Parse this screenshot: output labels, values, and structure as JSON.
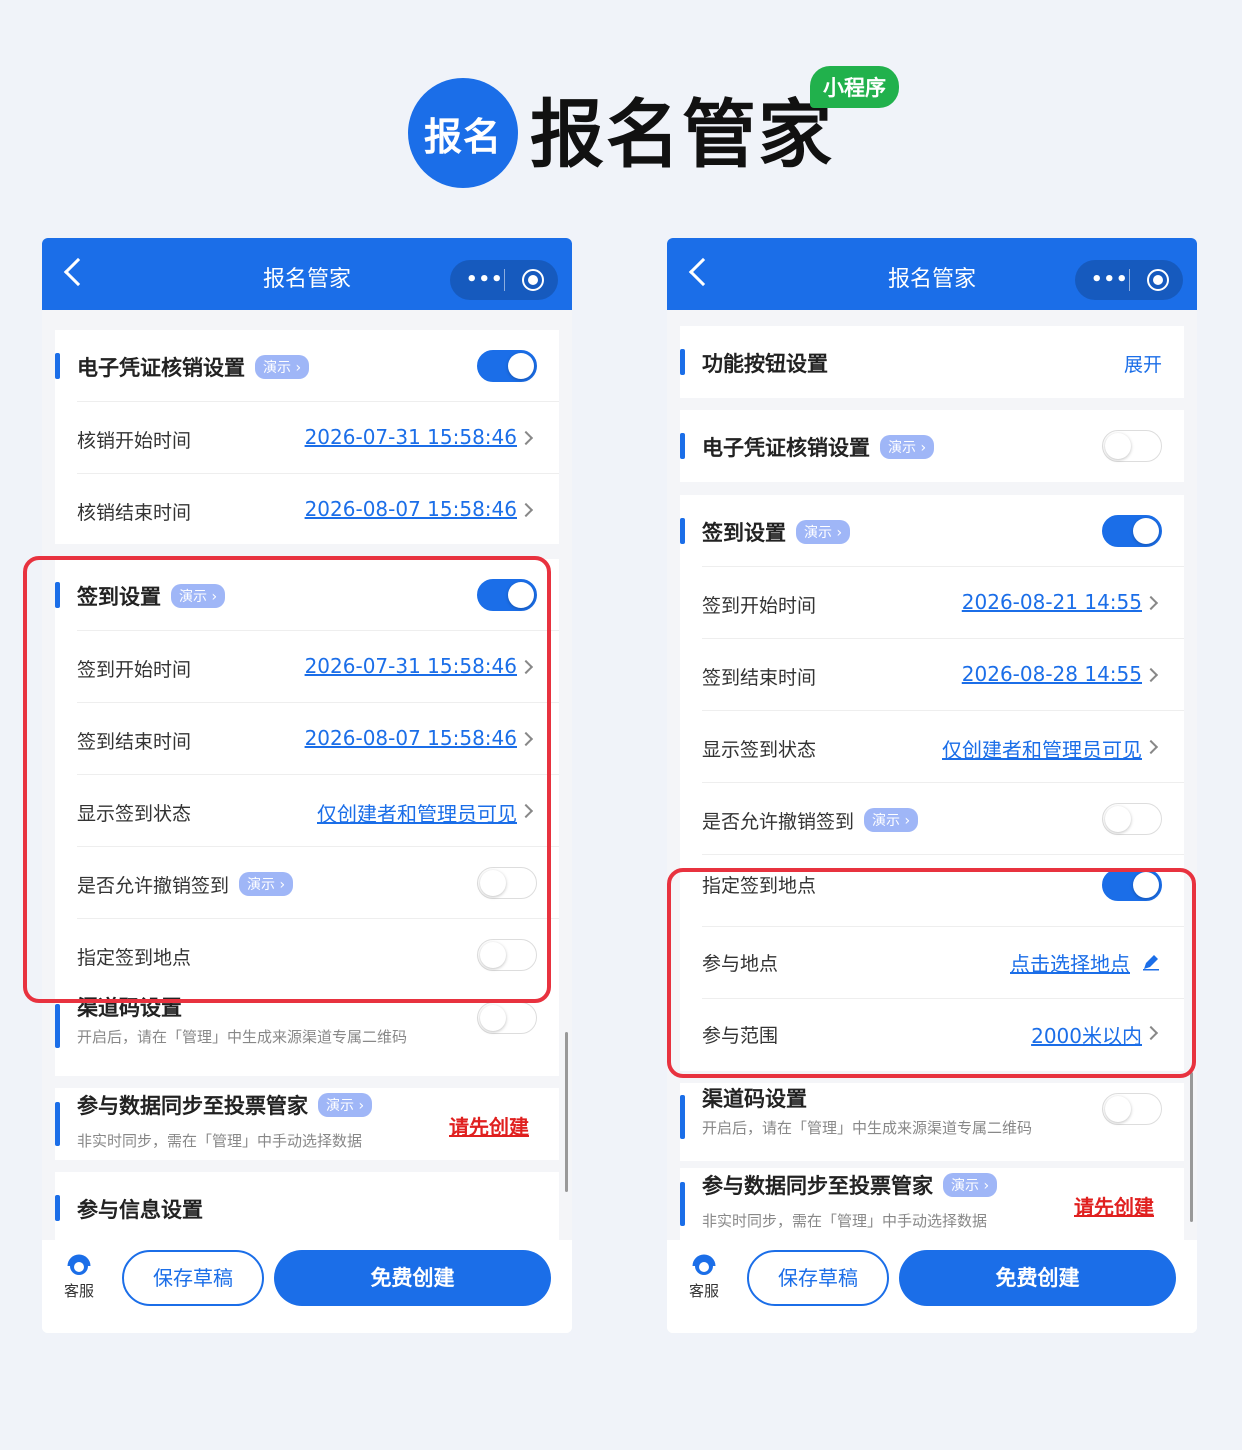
{
  "logo": {
    "circle_text": "报名",
    "app_name": "报名管家",
    "mini_badge": "小程序"
  },
  "colors": {
    "primary": "#1b6ee8",
    "highlight": "#e8323f",
    "warn": "#e0201f",
    "badge_green": "#21b14c"
  },
  "left": {
    "nav_title": "报名管家",
    "voucher": {
      "title": "电子凭证核销设置",
      "badge": "演示 ›",
      "toggle": "on"
    },
    "voucher_start": {
      "label": "核销开始时间",
      "value": "2026-07-31 15:58:46"
    },
    "voucher_end": {
      "label": "核销结束时间",
      "value": "2026-08-07 15:58:46"
    },
    "checkin": {
      "title": "签到设置",
      "badge": "演示 ›",
      "toggle": "on"
    },
    "checkin_start": {
      "label": "签到开始时间",
      "value": "2026-07-31 15:58:46"
    },
    "checkin_end": {
      "label": "签到结束时间",
      "value": "2026-08-07 15:58:46"
    },
    "show_status": {
      "label": "显示签到状态",
      "value": "仅创建者和管理员可见"
    },
    "allow_cancel": {
      "label": "是否允许撤销签到",
      "badge": "演示 ›",
      "toggle": "off"
    },
    "location": {
      "label": "指定签到地点",
      "toggle": "off"
    },
    "channel": {
      "title": "渠道码设置",
      "sub": "开启后，请在「管理」中生成来源渠道专属二维码",
      "toggle": "off"
    },
    "sync": {
      "title": "参与数据同步至投票管家",
      "badge": "演示 ›",
      "sub": "非实时同步，需在「管理」中手动选择数据",
      "action": "请先创建"
    },
    "info": {
      "title": "参与信息设置"
    },
    "bottom": {
      "service": "客服",
      "draft": "保存草稿",
      "create": "免费创建"
    }
  },
  "right": {
    "nav_title": "报名管家",
    "func": {
      "title": "功能按钮设置",
      "action": "展开"
    },
    "voucher": {
      "title": "电子凭证核销设置",
      "badge": "演示 ›",
      "toggle": "off"
    },
    "checkin": {
      "title": "签到设置",
      "badge": "演示 ›",
      "toggle": "on"
    },
    "checkin_start": {
      "label": "签到开始时间",
      "value": "2026-08-21 14:55"
    },
    "checkin_end": {
      "label": "签到结束时间",
      "value": "2026-08-28 14:55"
    },
    "show_status": {
      "label": "显示签到状态",
      "value": "仅创建者和管理员可见"
    },
    "allow_cancel": {
      "label": "是否允许撤销签到",
      "badge": "演示 ›",
      "toggle": "off"
    },
    "location": {
      "label": "指定签到地点",
      "toggle": "on"
    },
    "place": {
      "label": "参与地点",
      "value": "点击选择地点"
    },
    "range": {
      "label": "参与范围",
      "value": "2000米以内"
    },
    "channel": {
      "title": "渠道码设置",
      "sub": "开启后，请在「管理」中生成来源渠道专属二维码",
      "toggle": "off"
    },
    "sync": {
      "title": "参与数据同步至投票管家",
      "badge": "演示 ›",
      "sub": "非实时同步，需在「管理」中手动选择数据",
      "action": "请先创建"
    },
    "bottom": {
      "service": "客服",
      "draft": "保存草稿",
      "create": "免费创建"
    }
  }
}
